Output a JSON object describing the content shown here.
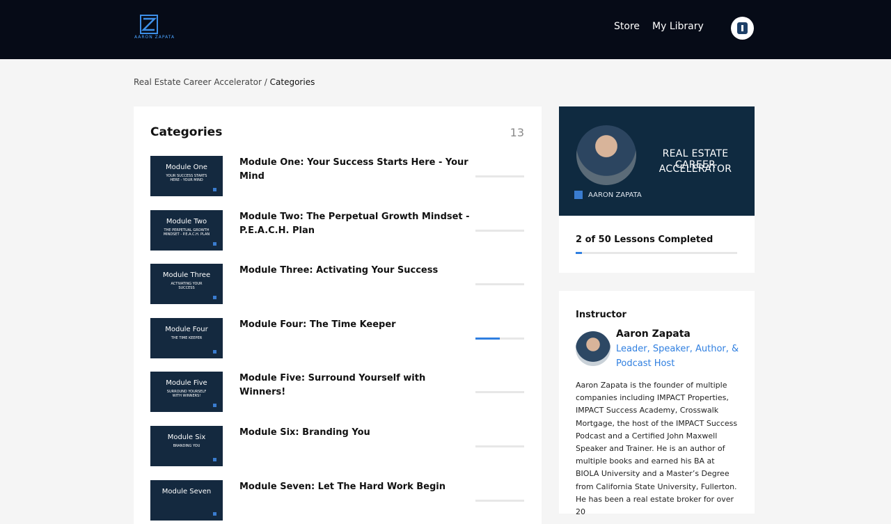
{
  "header": {
    "logo_text": "AARON ZAPATA",
    "nav": [
      "Store",
      "My Library"
    ]
  },
  "breadcrumb": {
    "parent": "Real Estate Career Accelerator",
    "separator": " / ",
    "current": "Categories"
  },
  "categories": {
    "title": "Categories",
    "count": "13",
    "modules": [
      {
        "thumb_title": "Module One",
        "thumb_sub": "Your Success Starts Here - Your Mind",
        "title": "Module One: Your Success Starts Here - Your Mind",
        "progress": 0
      },
      {
        "thumb_title": "Module Two",
        "thumb_sub": "The Perpetual Growth Mindset - P.E.A.C.H. Plan",
        "title": "Module Two: The Perpetual Growth Mindset - P.E.A.C.H. Plan",
        "progress": 0
      },
      {
        "thumb_title": "Module Three",
        "thumb_sub": "Activating Your Success",
        "title": "Module Three: Activating Your Success",
        "progress": 0
      },
      {
        "thumb_title": "Module Four",
        "thumb_sub": "The Time Keeper",
        "title": "Module Four: The Time Keeper",
        "progress": 0.5
      },
      {
        "thumb_title": "Module Five",
        "thumb_sub": "Surround Yourself With Winners!",
        "title": "Module Five: Surround Yourself with Winners!",
        "progress": 0
      },
      {
        "thumb_title": "Module Six",
        "thumb_sub": "Branding You",
        "title": "Module Six: Branding You",
        "progress": 0
      },
      {
        "thumb_title": "Module Seven",
        "thumb_sub": "",
        "title": "Module Seven: Let The Hard Work Begin",
        "progress": 0
      }
    ]
  },
  "course": {
    "banner_line1": "REAL ESTATE CAREER",
    "banner_line2": "ACCELERATOR",
    "banner_brand": "AARON ZAPATA",
    "lessons_completed": "2 of 50 Lessons Completed",
    "lessons_done": 2,
    "lessons_total": 50
  },
  "instructor": {
    "heading": "Instructor",
    "name": "Aaron Zapata",
    "role": "Leader, Speaker, Author, & Podcast Host",
    "bio": "Aaron Zapata is the founder of multiple companies including IMPACT Properties, IMPACT Success Academy, Crosswalk Mortgage, the host of the IMPACT Success Podcast and a Certified John Maxwell Speaker and Trainer. He is an author of multiple books and earned his BA at BIOLA University and a Master’s Degree from California State University, Fullerton. He has been a real estate broker for over 20"
  },
  "colors": {
    "header_bg": "#060b17",
    "accent": "#2f7fe0",
    "thumb_bg": "#14293f"
  }
}
